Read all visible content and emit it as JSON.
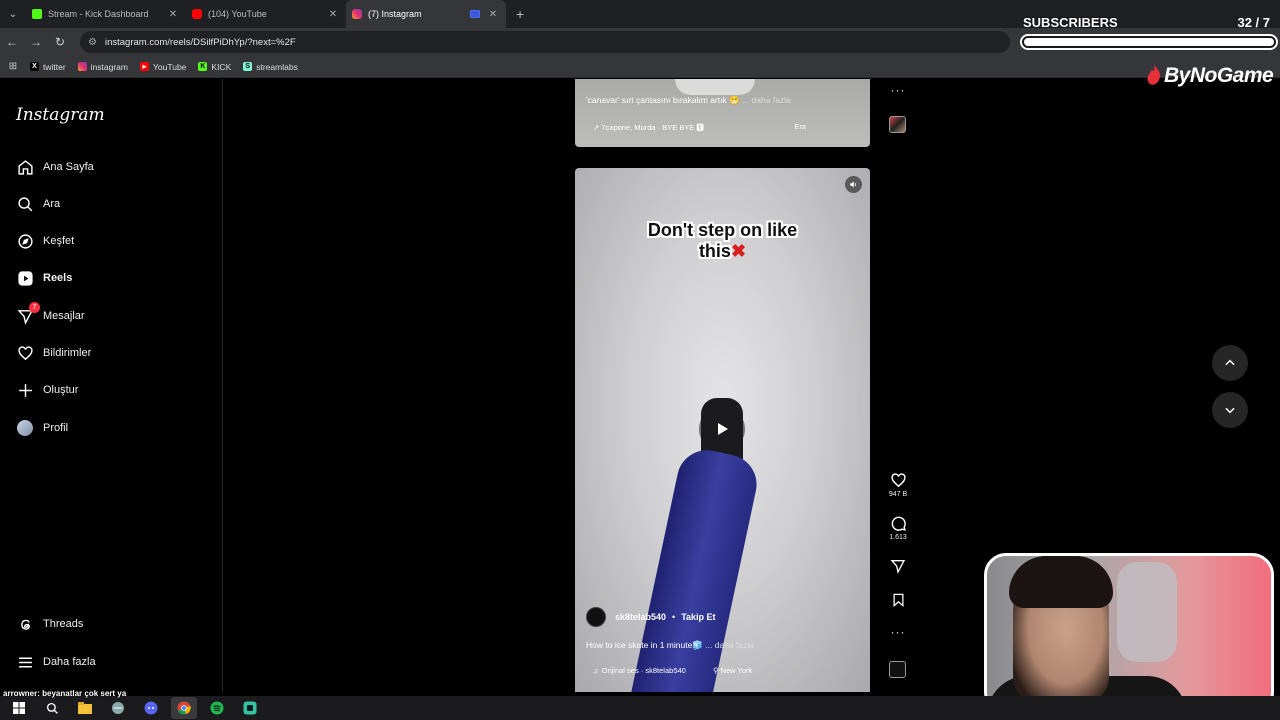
{
  "browser": {
    "tabs": [
      {
        "label": "Stream - Kick Dashboard",
        "favicon_color": "#53fc18",
        "favicon_letter": "K"
      },
      {
        "label": "(104) YouTube",
        "favicon_color": "#ff0000",
        "favicon_letter": "▶"
      },
      {
        "label": "(7) Instagram",
        "favicon_color": "#e1306c",
        "favicon_letter": "◎"
      }
    ],
    "url": "instagram.com/reels/DSilfPiDhYp/?next=%2F",
    "bookmarks": [
      {
        "label": "twitter",
        "icon": "x-icon",
        "color": "#000000",
        "glyph": "X"
      },
      {
        "label": "instagram",
        "icon": "instagram-icon",
        "color": "#e1306c",
        "glyph": "◎"
      },
      {
        "label": "YouTube",
        "icon": "youtube-icon",
        "color": "#ff0000",
        "glyph": "▶"
      },
      {
        "label": "KICK",
        "icon": "kick-icon",
        "color": "#53fc18",
        "glyph": "K"
      },
      {
        "label": "streamlabs",
        "icon": "streamlabs-icon",
        "color": "#80f5d2",
        "glyph": "S"
      }
    ]
  },
  "overlay": {
    "subscribers_title": "SUBSCRIBERS",
    "subscribers_count": "32  / 7",
    "subscribers_progress": 1.0,
    "brand": "ByNoGame",
    "chat_user": "arrowner",
    "chat_text": ": beyanatlar çok sert ya"
  },
  "instagram": {
    "logo": "Instagram",
    "nav": [
      {
        "label": "Ana Sayfa",
        "icon": "home-icon"
      },
      {
        "label": "Ara",
        "icon": "search-icon"
      },
      {
        "label": "Keşfet",
        "icon": "compass-icon"
      },
      {
        "label": "Reels",
        "icon": "reels-icon",
        "active": true
      },
      {
        "label": "Mesajlar",
        "icon": "messenger-icon",
        "badge": "7"
      },
      {
        "label": "Bildirimler",
        "icon": "heart-icon"
      },
      {
        "label": "Oluştur",
        "icon": "plus-icon"
      },
      {
        "label": "Profil",
        "icon": "avatar-icon"
      }
    ],
    "nav_bottom": [
      {
        "label": "Threads",
        "icon": "threads-icon"
      },
      {
        "label": "Daha fazla",
        "icon": "menu-icon"
      }
    ],
    "prev_reel": {
      "caption": "'canavar' sırt çantasını bırakalım artık 😁",
      "more": "... daha fazla",
      "audio": "↗ 7capone, Murda · BYE BYE 🅴",
      "location": "Era"
    },
    "reel": {
      "overlay_line1": "Don't step on like",
      "overlay_line2": "this",
      "overlay_mark": "✖",
      "username": "sk8telab540",
      "follow": "Takip Et",
      "caption": "How to ice skate in 1 minute🧊",
      "more": "... daha fazla",
      "audio": "Orijinal ses · sk8telab540",
      "location": "New York",
      "likes": "947 B",
      "comments": "1.613"
    }
  }
}
